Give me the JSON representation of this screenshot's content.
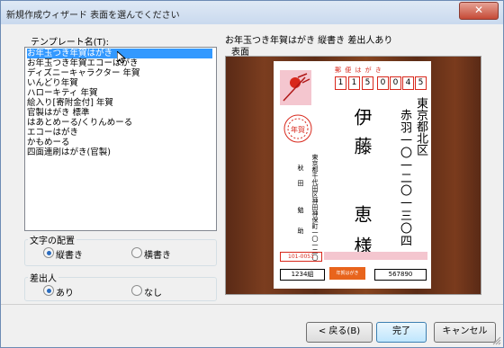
{
  "window": {
    "title": "新規作成ウィザード 表面を選んでください",
    "close": "✕"
  },
  "template_label": "テンプレート名(T):",
  "templates": [
    "お年玉つき年賀はがき",
    "お年玉つき年賀エコーはがき",
    "ディズニーキャラクター 年賀",
    "いんどり年賀",
    "ハローキティ 年賀",
    "絵入り[寄附金付] 年賀",
    "官製はがき 標準",
    "はあとめーる/くりんめーる",
    "エコーはがき",
    "かもめーる",
    "四面連刷はがき(官製)"
  ],
  "layout_group": {
    "label": "文字の配置",
    "options": [
      "縦書き",
      "横書き"
    ],
    "selected": "縦書き"
  },
  "sender_group": {
    "label": "差出人",
    "options": [
      "あり",
      "なし"
    ],
    "selected": "あり"
  },
  "preview": {
    "heading": "お年玉つき年賀はがき 縦書き 差出人あり",
    "side_label": "表面",
    "card_header": "郵 便 は が き",
    "zip": [
      "1",
      "1",
      "5",
      "0",
      "0",
      "4",
      "5"
    ],
    "recipient_address_1": "東京都北区",
    "recipient_address_2": "赤羽一〇一二〇一三〇四",
    "recipient_surname": "伊藤",
    "recipient_given": "恵",
    "recipient_honorific": "様",
    "sender_address": "東京都千代田区神田神保町一〇一二〇",
    "sender_surname": "秋田",
    "sender_given": "勉",
    "sender_given_2": "助",
    "sender_zip": "101-0051",
    "lottery_left": "1234組",
    "lottery_right": "567890",
    "lottery_mid": "年賀はがき"
  },
  "buttons": {
    "back": "< 戻る(B)",
    "finish": "完了",
    "cancel": "キャンセル"
  },
  "colors": {
    "accent": "#3399ff",
    "stamp_red": "#d8281c",
    "wood": "#6b3219"
  }
}
